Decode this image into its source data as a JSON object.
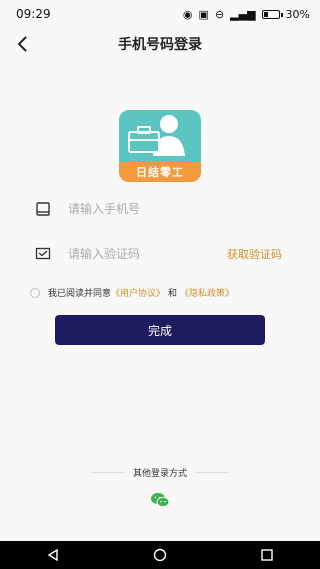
{
  "status": {
    "time": "09:29",
    "battery": "30%",
    "battery_level": 0.3
  },
  "header": {
    "title": "手机号码登录"
  },
  "logo": {
    "text": "日结零工"
  },
  "form": {
    "phone_placeholder": "请输入手机号",
    "code_placeholder": "请输入验证码",
    "get_code": "获取验证码",
    "submit": "完成"
  },
  "agreement": {
    "prefix": "我已阅读并同意",
    "user_agreement": "《用户协议》",
    "and": "和",
    "privacy_policy": "《隐私政策》"
  },
  "other_login": {
    "label": "其他登录方式"
  },
  "colors": {
    "accent": "#d1902a",
    "primary": "#1e1b5e",
    "logo_bg": "#5bc6c0",
    "logo_band": "#f29a3d"
  }
}
